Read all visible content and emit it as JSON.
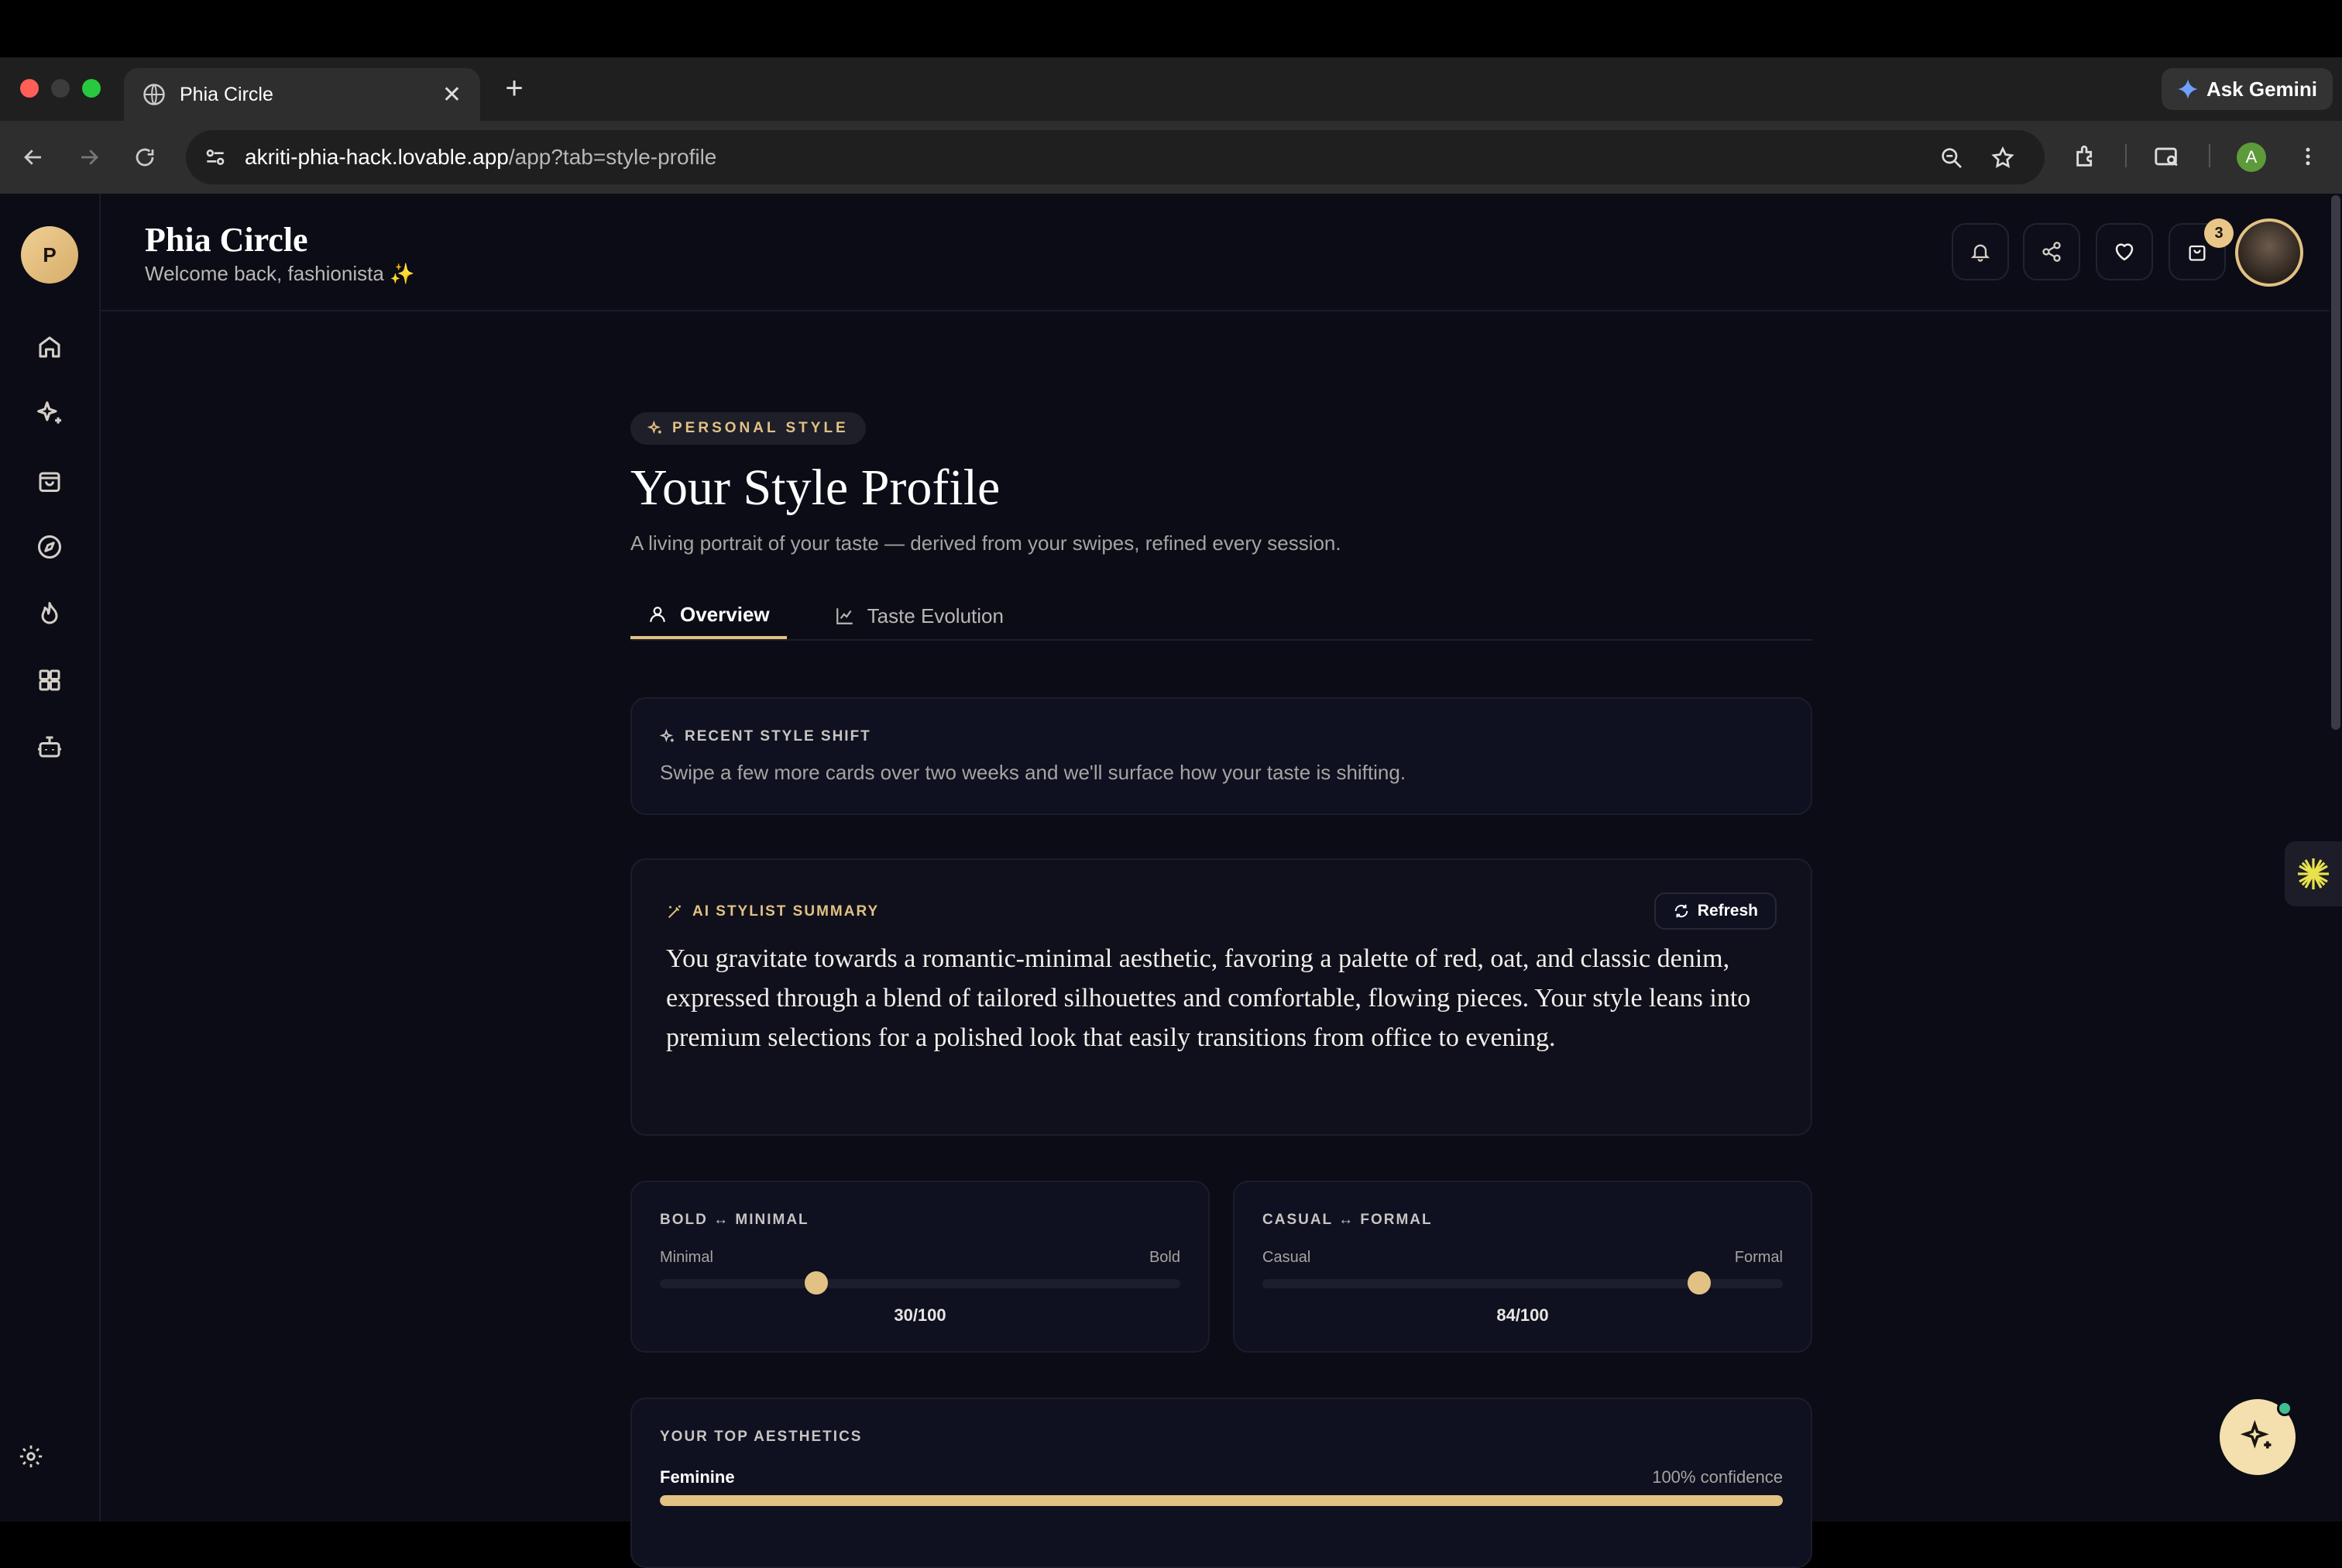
{
  "browser": {
    "tab_title": "Phia Circle",
    "url_host": "akriti-phia-hack.lovable.app",
    "url_path": "/app?tab=style-profile",
    "gemini_label": "Ask Gemini",
    "profile_initial": "A"
  },
  "app": {
    "logo_initial": "P",
    "brand": "Phia Circle",
    "welcome": "Welcome back, fashionista ✨",
    "cart_count": "3",
    "sidebar_items": [
      "home-icon",
      "sparkles-icon",
      "shopping-bag-icon",
      "compass-icon",
      "flame-icon",
      "grid-icon",
      "bot-icon",
      "settings-icon"
    ]
  },
  "profile": {
    "pill": "PERSONAL STYLE",
    "title": "Your Style Profile",
    "subtitle": "A living portrait of your taste — derived from your swipes, refined every session.",
    "tabs": [
      {
        "label": "Overview",
        "active": true
      },
      {
        "label": "Taste Evolution",
        "active": false
      }
    ],
    "recent_shift": {
      "label": "RECENT STYLE SHIFT",
      "text": "Swipe a few more cards over two weeks and we'll surface how your taste is shifting."
    },
    "summary": {
      "label": "AI STYLIST SUMMARY",
      "refresh": "Refresh",
      "text": "You gravitate towards a romantic-minimal aesthetic, favoring a palette of red, oat, and classic denim, expressed through a blend of tailored silhouettes and comfortable, flowing pieces. Your style leans into premium selections for a polished look that easily transitions from office to evening."
    },
    "sliders": [
      {
        "label": "BOLD ↔ MINIMAL",
        "left": "Minimal",
        "right": "Bold",
        "value": 30,
        "score": "30/100"
      },
      {
        "label": "CASUAL ↔ FORMAL",
        "left": "Casual",
        "right": "Formal",
        "value": 84,
        "score": "84/100"
      }
    ],
    "aesthetics": {
      "label": "YOUR TOP AESTHETICS",
      "items": [
        {
          "name": "Feminine",
          "confidence": "100% confidence",
          "value": 100
        }
      ]
    }
  },
  "colors": {
    "accent": "#e2c184",
    "background": "#0b0c16",
    "card": "#0f1020"
  }
}
